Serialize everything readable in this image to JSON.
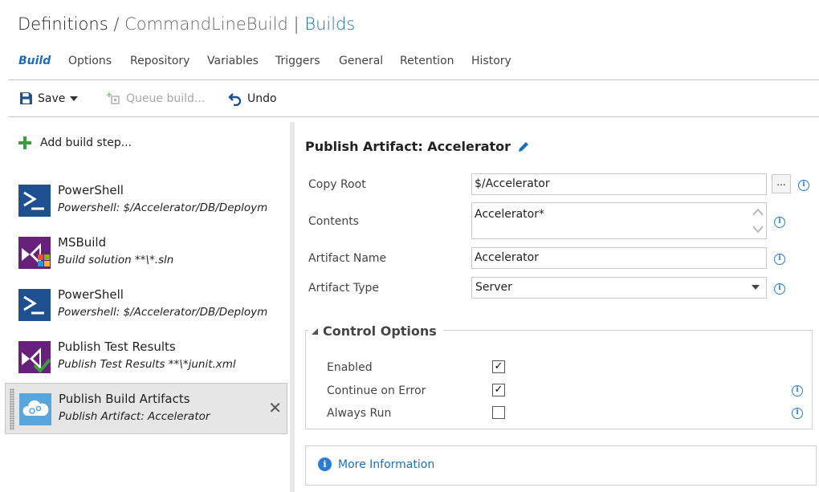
{
  "breadcrumb": {
    "root": "Definitions",
    "separator": "/",
    "definition": "CommandLineBuild",
    "pipe": "|",
    "section": "Builds"
  },
  "tabs": [
    {
      "label": "Build"
    },
    {
      "label": "Options"
    },
    {
      "label": "Repository"
    },
    {
      "label": "Variables"
    },
    {
      "label": "Triggers"
    },
    {
      "label": "General"
    },
    {
      "label": "Retention"
    },
    {
      "label": "History"
    }
  ],
  "toolbar": {
    "save_label": "Save",
    "queue_label": "Queue build...",
    "undo_label": "Undo"
  },
  "left": {
    "add_step_label": "Add build step...",
    "steps": [
      {
        "title": "PowerShell",
        "subtitle": "Powershell: $/Accelerator/DB/Deployme",
        "icon": "powershell-icon"
      },
      {
        "title": "MSBuild",
        "subtitle": "Build solution **\\*.sln",
        "icon": "msbuild-icon"
      },
      {
        "title": "PowerShell",
        "subtitle": "Powershell: $/Accelerator/DB/Deployme",
        "icon": "powershell-icon"
      },
      {
        "title": "Publish Test Results",
        "subtitle": "Publish Test Results **\\*junit.xml",
        "icon": "test-results-icon"
      },
      {
        "title": "Publish Build Artifacts",
        "subtitle": "Publish Artifact: Accelerator",
        "icon": "artifacts-cloud-icon",
        "selected": true
      }
    ]
  },
  "panel": {
    "title": "Publish Artifact: Accelerator",
    "fields": {
      "copy_root": {
        "label": "Copy Root",
        "value": "$/Accelerator",
        "browse_label": "..."
      },
      "contents": {
        "label": "Contents",
        "value": "Accelerator*"
      },
      "artifact_name": {
        "label": "Artifact Name",
        "value": "Accelerator"
      },
      "artifact_type": {
        "label": "Artifact Type",
        "value": "Server"
      }
    },
    "control_options": {
      "title": "Control Options",
      "enabled": {
        "label": "Enabled",
        "checked": true
      },
      "continue_on_error": {
        "label": "Continue on Error",
        "checked": true
      },
      "always_run": {
        "label": "Always Run",
        "checked": false
      }
    },
    "more_info_label": "More Information"
  },
  "colors": {
    "accent": "#1b6fc0",
    "info": "#2a7bd4",
    "add_green": "#3c9d3c",
    "powershell_blue": "#1d4f91",
    "msbuild_purple": "#68217a"
  }
}
